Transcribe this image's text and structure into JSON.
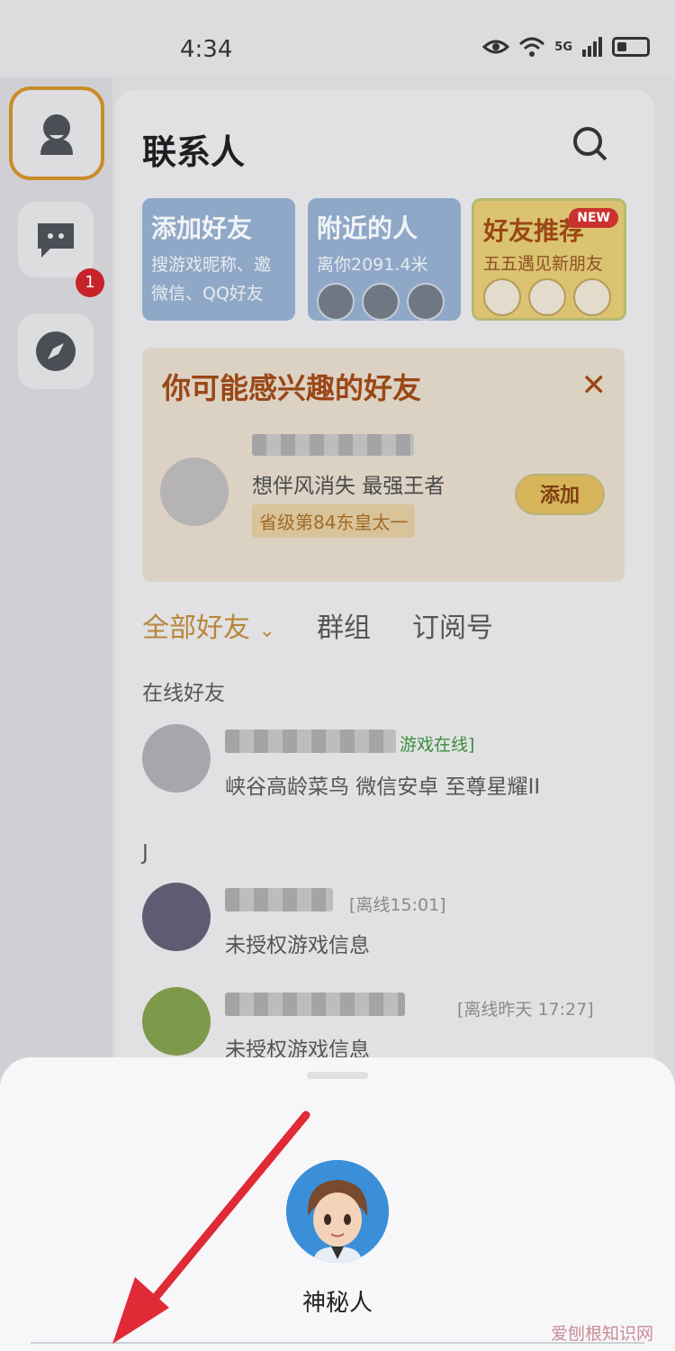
{
  "status_bar": {
    "time": "4:34",
    "network": "5G"
  },
  "rail": {
    "message_badge": "1"
  },
  "header": {
    "title": "联系人"
  },
  "cards": {
    "add_friend": {
      "title": "添加好友",
      "line1": "搜游戏昵称、邀",
      "line2": "微信、QQ好友"
    },
    "nearby": {
      "title": "附近的人",
      "distance": "离你2091.4米"
    },
    "recommend": {
      "title": "好友推荐",
      "badge": "NEW",
      "subtitle": "五五遇见新朋友"
    }
  },
  "interest": {
    "title": "你可能感兴趣的好友",
    "desc": "想伴风消失 最强王者",
    "tag": "省级第84东皇太一",
    "add_label": "添加"
  },
  "tabs": [
    "全部好友",
    "群组",
    "订阅号"
  ],
  "sections": {
    "online": "在线好友",
    "j": "J"
  },
  "friends": [
    {
      "status": "游戏在线]",
      "line": "峡谷高龄菜鸟 微信安卓 至尊星耀II"
    },
    {
      "status": "[离线15:01]",
      "line": "未授权游戏信息"
    },
    {
      "status": "[离线昨天 17:27]",
      "line": "未授权游戏信息"
    }
  ],
  "sheet": {
    "name": "神秘人"
  },
  "watermark": "爱刨根知识网",
  "colors": {
    "accent": "#b88739",
    "badge": "#c6232a",
    "arrow": "#e02a36"
  }
}
